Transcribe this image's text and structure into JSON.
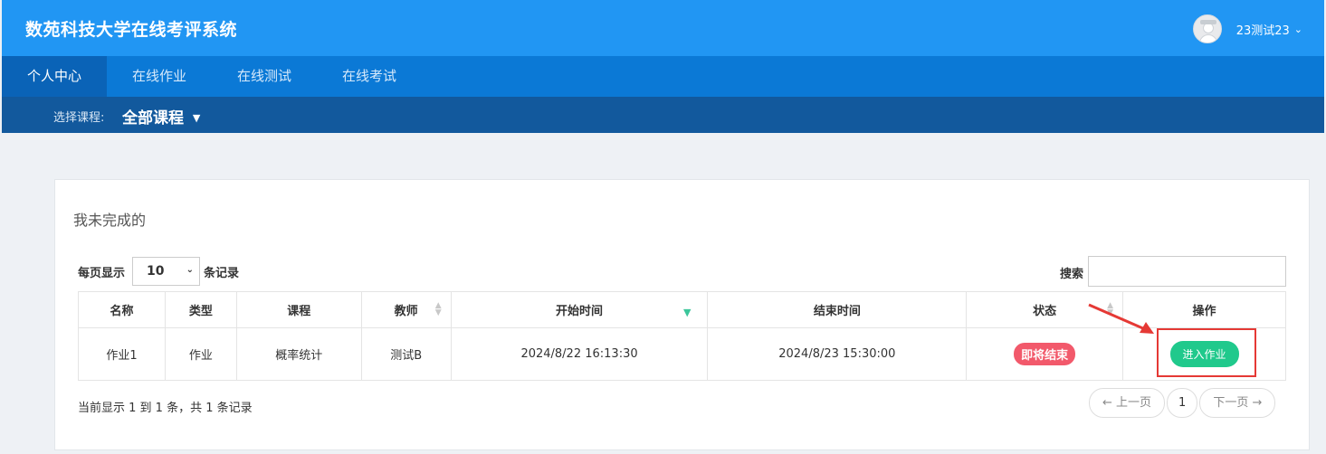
{
  "header": {
    "app_title": "数苑科技大学在线考评系统",
    "username": "23测试23"
  },
  "nav": {
    "items": [
      {
        "label": "个人中心",
        "active": true
      },
      {
        "label": "在线作业",
        "active": false
      },
      {
        "label": "在线测试",
        "active": false
      },
      {
        "label": "在线考试",
        "active": false
      }
    ]
  },
  "course": {
    "label": "选择课程:",
    "selected": "全部课程"
  },
  "panel": {
    "title": "我未完成的",
    "page_size_prefix": "每页显示",
    "page_size": "10",
    "page_size_suffix": "条记录",
    "search_label": "搜索",
    "search_value": "",
    "columns": [
      "名称",
      "类型",
      "课程",
      "教师",
      "开始时间",
      "结束时间",
      "状态",
      "操作"
    ],
    "rows": [
      {
        "name": "作业1",
        "type": "作业",
        "course": "概率统计",
        "teacher": "测试B",
        "start": "2024/8/22 16:13:30",
        "end": "2024/8/23 15:30:00",
        "status": "即将结束",
        "action": "进入作业"
      }
    ],
    "info": "当前显示 1 到 1 条，共 1 条记录",
    "pager": {
      "prev": "← 上一页",
      "page": "1",
      "next": "下一页 →"
    }
  },
  "colors": {
    "header": "#2196f3",
    "nav": "#0b79d6",
    "course_bar": "#12599d",
    "status_badge": "#f2596b",
    "action_button": "#20c98c",
    "highlight": "#e53935"
  }
}
